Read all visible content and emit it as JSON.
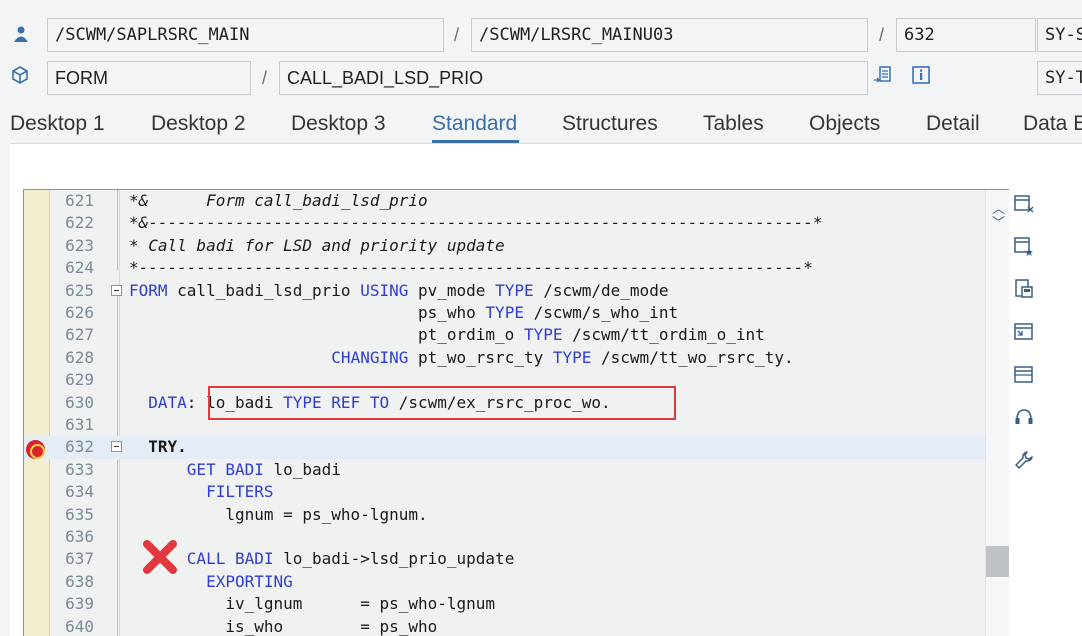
{
  "program": {
    "main_program": "/SCWM/SAPLRSRC_MAIN",
    "include": "/SCWM/LRSRC_MAINU03",
    "line": "632",
    "sy_field_1": "SY-S",
    "event_type": "FORM",
    "event_name": "CALL_BADI_LSD_PRIO",
    "sy_field_2": "SY-T"
  },
  "icons": {
    "program_icon": "program-person-icon",
    "event_icon": "cube-icon",
    "navigate_icon": "navigate-list-icon",
    "info_icon": "info-icon"
  },
  "separators": [
    "/",
    "/",
    "/"
  ],
  "tabs": [
    {
      "label": "Desktop 1"
    },
    {
      "label": "Desktop 2"
    },
    {
      "label": "Desktop 3"
    },
    {
      "label": "Standard",
      "active": true
    },
    {
      "label": "Structures"
    },
    {
      "label": "Tables"
    },
    {
      "label": "Objects"
    },
    {
      "label": "Detail"
    },
    {
      "label": "Data E"
    }
  ],
  "code_lines": [
    {
      "num": "621",
      "text": "*&      Form call_badi_lsd_prio"
    },
    {
      "num": "622",
      "text": "*&---------------------------------------------------------------------*"
    },
    {
      "num": "623",
      "text": "* Call badi for LSD and priority update"
    },
    {
      "num": "624",
      "text": "*---------------------------------------------------------------------*"
    },
    {
      "num": "625",
      "text": "FORM call_badi_lsd_prio USING pv_mode TYPE /scwm/de_mode"
    },
    {
      "num": "626",
      "text": "                              ps_who TYPE /scwm/s_who_int"
    },
    {
      "num": "627",
      "text": "                              pt_ordim_o TYPE /scwm/tt_ordim_o_int"
    },
    {
      "num": "628",
      "text": "                     CHANGING pt_wo_rsrc_ty TYPE /scwm/tt_wo_rsrc_ty."
    },
    {
      "num": "629",
      "text": ""
    },
    {
      "num": "630",
      "text": "  DATA: lo_badi TYPE REF TO /scwm/ex_rsrc_proc_wo."
    },
    {
      "num": "631",
      "text": ""
    },
    {
      "num": "632",
      "text": "  TRY."
    },
    {
      "num": "633",
      "text": "      GET BADI lo_badi"
    },
    {
      "num": "634",
      "text": "        FILTERS"
    },
    {
      "num": "635",
      "text": "          lgnum = ps_who-lgnum."
    },
    {
      "num": "636",
      "text": ""
    },
    {
      "num": "637",
      "text": "      CALL BADI lo_badi->lsd_prio_update"
    },
    {
      "num": "638",
      "text": "        EXPORTING"
    },
    {
      "num": "639",
      "text": "          iv_lgnum      = ps_who-lgnum"
    },
    {
      "num": "640",
      "text": "          is_who        = ps_who"
    }
  ],
  "right_toolbar": [
    "delete-breakpoint-icon",
    "set-watchpoint-icon",
    "save-source-icon",
    "display-window-icon",
    "layout-icon",
    "headset-icon",
    "wrench-icon"
  ],
  "colors": {
    "keyword": "#2f3dd4",
    "comment": "#8a8f96",
    "highlight_box": "#e03a3a",
    "active_tab": "#3a6fa8"
  }
}
